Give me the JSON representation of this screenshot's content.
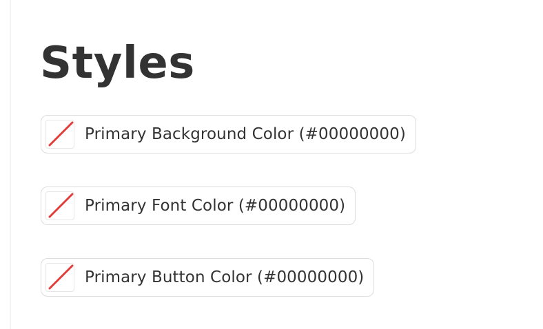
{
  "page": {
    "title": "Styles"
  },
  "colors": {
    "no_color_slash": "#e03c3c",
    "border": "#dcdcdc",
    "text": "#333333"
  },
  "color_pickers": [
    {
      "label": "Primary Background Color (#00000000)",
      "value": "#00000000",
      "swatch_icon": "transparent-color-swatch-icon"
    },
    {
      "label": "Primary Font Color (#00000000)",
      "value": "#00000000",
      "swatch_icon": "transparent-color-swatch-icon"
    },
    {
      "label": "Primary Button Color (#00000000)",
      "value": "#00000000",
      "swatch_icon": "transparent-color-swatch-icon"
    }
  ]
}
